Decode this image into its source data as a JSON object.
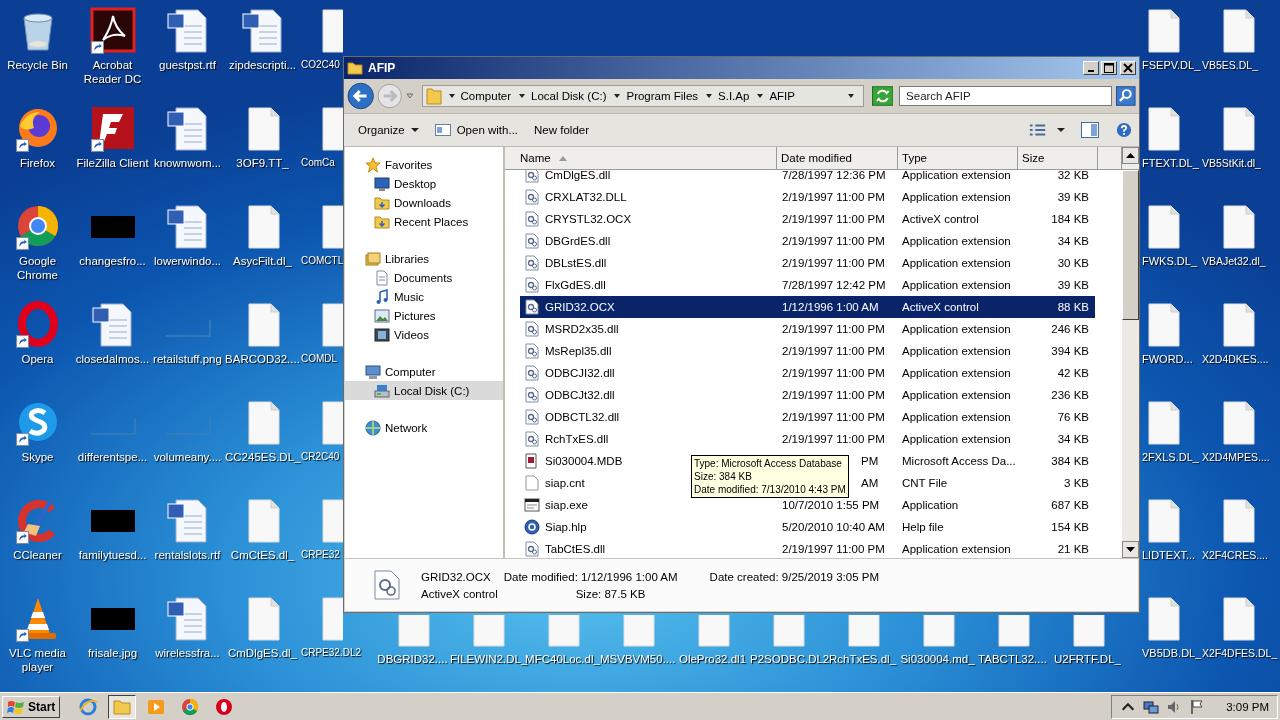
{
  "desktop": {
    "left_columns": [
      [
        {
          "label": "Recycle Bin",
          "kind": "recycle",
          "shortcut": false
        },
        {
          "label": "Firefox",
          "kind": "firefox",
          "shortcut": true
        },
        {
          "label": "Google Chrome",
          "kind": "chrome",
          "shortcut": true
        },
        {
          "label": "Opera",
          "kind": "opera",
          "shortcut": true
        },
        {
          "label": "Skype",
          "kind": "skype",
          "shortcut": true
        },
        {
          "label": "CCleaner",
          "kind": "ccleaner",
          "shortcut": true
        },
        {
          "label": "VLC media player",
          "kind": "vlc",
          "shortcut": true
        }
      ],
      [
        {
          "label": "Acrobat Reader DC",
          "kind": "acrobat",
          "shortcut": true
        },
        {
          "label": "FileZilla Client",
          "kind": "filezilla",
          "shortcut": true
        },
        {
          "label": "changesfro...",
          "kind": "thumb_dark",
          "shortcut": false
        },
        {
          "label": "closedalmos...",
          "kind": "word",
          "shortcut": false
        },
        {
          "label": "differentspe...",
          "kind": "thumb_light",
          "shortcut": false
        },
        {
          "label": "familytuesd...",
          "kind": "thumb_dark",
          "shortcut": false
        },
        {
          "label": "frisale.jpg",
          "kind": "thumb_dark",
          "shortcut": false
        }
      ],
      [
        {
          "label": "guestpst.rtf",
          "kind": "word",
          "shortcut": false
        },
        {
          "label": "knownwom...",
          "kind": "word",
          "shortcut": false
        },
        {
          "label": "lowerwindo...",
          "kind": "word",
          "shortcut": false
        },
        {
          "label": "retailstuff.png",
          "kind": "thumb_light",
          "shortcut": false
        },
        {
          "label": "volumeany....",
          "kind": "thumb_light",
          "shortcut": false
        },
        {
          "label": "rentalslots.rtf",
          "kind": "word",
          "shortcut": false
        },
        {
          "label": "wirelessfra...",
          "kind": "word",
          "shortcut": false
        }
      ],
      [
        {
          "label": "zipdescripti...",
          "kind": "word",
          "shortcut": false
        },
        {
          "label": "3OF9.TT_",
          "kind": "blank",
          "shortcut": false
        },
        {
          "label": "AsycFilt.dl_",
          "kind": "blank",
          "shortcut": false
        },
        {
          "label": "BARCOD32....",
          "kind": "blank",
          "shortcut": false
        },
        {
          "label": "CC245ES.DL_",
          "kind": "blank",
          "shortcut": false
        },
        {
          "label": "CmCtES.dl_",
          "kind": "blank",
          "shortcut": false
        },
        {
          "label": "CmDlgES.dl_",
          "kind": "blank",
          "shortcut": false
        }
      ],
      [
        {
          "label": "CO2C40",
          "kind": "blank",
          "shortcut": false
        },
        {
          "label": "ComCa",
          "kind": "blank",
          "shortcut": false
        },
        {
          "label": "COMCTL",
          "kind": "blank",
          "shortcut": false
        },
        {
          "label": "COMDL",
          "kind": "blank",
          "shortcut": false
        },
        {
          "label": "CR2C40",
          "kind": "blank",
          "shortcut": false
        },
        {
          "label": "CRPE32",
          "kind": "blank",
          "shortcut": false
        },
        {
          "label": "CRPE32.DL2",
          "kind": "blank",
          "shortcut": false
        }
      ]
    ],
    "bottom_row": [
      {
        "label": "DBGRID32....",
        "kind": "blank",
        "shortcut": false
      },
      {
        "label": "FILEWIN2.DL_",
        "kind": "blank",
        "shortcut": false
      },
      {
        "label": "MFC40Loc.dl_",
        "kind": "blank",
        "shortcut": false
      },
      {
        "label": "MSVBVM50....",
        "kind": "blank",
        "shortcut": false
      },
      {
        "label": "OlePro32.dl1",
        "kind": "blank",
        "shortcut": false
      },
      {
        "label": "P2SODBC.DL2",
        "kind": "blank",
        "shortcut": false
      },
      {
        "label": "RchTxES.dl_",
        "kind": "blank",
        "shortcut": false
      },
      {
        "label": "Si030004.md_",
        "kind": "blank",
        "shortcut": false
      },
      {
        "label": "TABCTL32....",
        "kind": "blank",
        "shortcut": false
      },
      {
        "label": "U2FRTF.DL_",
        "kind": "blank",
        "shortcut": false
      }
    ],
    "right_columns": [
      [
        {
          "label": "FSEPV.DL_",
          "kind": "blank",
          "shortcut": false
        },
        {
          "label": "FTEXT.DL_",
          "kind": "blank",
          "shortcut": false
        },
        {
          "label": "FWKS.DL_",
          "kind": "blank",
          "shortcut": false
        },
        {
          "label": "FWORD...",
          "kind": "blank",
          "shortcut": false
        },
        {
          "label": "2FXLS.DL_",
          "kind": "blank",
          "shortcut": false
        },
        {
          "label": "LIDTEXT...",
          "kind": "blank",
          "shortcut": false
        },
        {
          "label": "VB5DB.DL_",
          "kind": "blank",
          "shortcut": false
        }
      ],
      [
        {
          "label": "VB5ES.DL_",
          "kind": "blank",
          "shortcut": false
        },
        {
          "label": "VB5StKit.dl_",
          "kind": "blank",
          "shortcut": false
        },
        {
          "label": "VBAJet32.dl_",
          "kind": "blank",
          "shortcut": false
        },
        {
          "label": "X2D4DKES....",
          "kind": "blank",
          "shortcut": false
        },
        {
          "label": "X2D4MPES....",
          "kind": "blank",
          "shortcut": false
        },
        {
          "label": "X2F4CRES....",
          "kind": "blank",
          "shortcut": false
        },
        {
          "label": "X2F4DFES.DL_",
          "kind": "blank",
          "shortcut": false
        }
      ]
    ]
  },
  "window": {
    "title": "AFIP",
    "breadcrumbs": [
      "Computer",
      "Local Disk (C:)",
      "Program Files",
      "S.I.Ap",
      "AFIP"
    ],
    "search": {
      "placeholder": "Search AFIP"
    },
    "toolbar": [
      {
        "label": "Organize",
        "kind": "menu"
      },
      {
        "label": "Open with...",
        "kind": "open"
      },
      {
        "label": "New folder",
        "kind": "plain"
      }
    ],
    "nav": [
      {
        "label": "Favorites",
        "kind": "star",
        "selected": false,
        "children": [
          {
            "label": "Desktop",
            "kind": "desktop",
            "selected": false
          },
          {
            "label": "Downloads",
            "kind": "downloads",
            "selected": false
          },
          {
            "label": "Recent Places",
            "kind": "recent",
            "selected": false
          }
        ]
      },
      {
        "label": "Libraries",
        "kind": "libraries",
        "selected": false,
        "children": [
          {
            "label": "Documents",
            "kind": "documents",
            "selected": false
          },
          {
            "label": "Music",
            "kind": "music",
            "selected": false
          },
          {
            "label": "Pictures",
            "kind": "pictures",
            "selected": false
          },
          {
            "label": "Videos",
            "kind": "videos",
            "selected": false
          }
        ]
      },
      {
        "label": "Computer",
        "kind": "computer",
        "selected": false,
        "children": [
          {
            "label": "Local Disk (C:)",
            "kind": "disk",
            "selected": true
          }
        ]
      },
      {
        "label": "Network",
        "kind": "network",
        "selected": false
      }
    ],
    "columns": [
      {
        "label": "Name",
        "sorted": true
      },
      {
        "label": "Date modified",
        "sorted": false
      },
      {
        "label": "Type",
        "sorted": false
      },
      {
        "label": "Size",
        "sorted": false
      }
    ],
    "files": [
      {
        "name": "CmDlgES.dll",
        "date": "7/28/1997 12:36 PM",
        "type": "Application extension",
        "size": "32 KB",
        "kind": "dll",
        "selected": false
      },
      {
        "name": "CRXLAT32.DLL",
        "date": "2/19/1997 11:00 PM",
        "type": "Application extension",
        "size": "39 KB",
        "kind": "dll",
        "selected": false
      },
      {
        "name": "CRYSTL32.OCX",
        "date": "2/19/1997 11:00 PM",
        "type": "ActiveX control",
        "size": "184 KB",
        "kind": "dll",
        "selected": false
      },
      {
        "name": "DBGrdES.dll",
        "date": "2/19/1997 11:00 PM",
        "type": "Application extension",
        "size": "34 KB",
        "kind": "dll",
        "selected": false
      },
      {
        "name": "DBLstES.dll",
        "date": "2/19/1997 11:00 PM",
        "type": "Application extension",
        "size": "30 KB",
        "kind": "dll",
        "selected": false
      },
      {
        "name": "FlxGdES.dll",
        "date": "7/28/1997 12:42 PM",
        "type": "Application extension",
        "size": "39 KB",
        "kind": "dll",
        "selected": false
      },
      {
        "name": "GRID32.OCX",
        "date": "1/12/1996 1:00 AM",
        "type": "ActiveX control",
        "size": "88 KB",
        "kind": "dll",
        "selected": true
      },
      {
        "name": "MSRD2x35.dll",
        "date": "2/19/1997 11:00 PM",
        "type": "Application extension",
        "size": "246 KB",
        "kind": "dll",
        "selected": false
      },
      {
        "name": "MsRepl35.dll",
        "date": "2/19/1997 11:00 PM",
        "type": "Application extension",
        "size": "394 KB",
        "kind": "dll",
        "selected": false
      },
      {
        "name": "ODBCJI32.dll",
        "date": "2/19/1997 11:00 PM",
        "type": "Application extension",
        "size": "42 KB",
        "kind": "dll",
        "selected": false
      },
      {
        "name": "ODBCJt32.dll",
        "date": "2/19/1997 11:00 PM",
        "type": "Application extension",
        "size": "236 KB",
        "kind": "dll",
        "selected": false
      },
      {
        "name": "ODBCTL32.dll",
        "date": "2/19/1997 11:00 PM",
        "type": "Application extension",
        "size": "76 KB",
        "kind": "dll",
        "selected": false
      },
      {
        "name": "RchTxES.dll",
        "date": "2/19/1997 11:00 PM",
        "type": "Application extension",
        "size": "34 KB",
        "kind": "dll",
        "selected": false
      },
      {
        "name": "Si030004.MDB",
        "date": "PM",
        "date_covered": true,
        "type": "Microsoft Access Da...",
        "size": "384 KB",
        "kind": "mdb",
        "selected": false
      },
      {
        "name": "siap.cnt",
        "date": "AM",
        "date_covered": true,
        "type": "CNT File",
        "size": "3 KB",
        "kind": "blank",
        "selected": false
      },
      {
        "name": "siap.exe",
        "date": "10/7/2010 1:55 PM",
        "type": "Application",
        "size": "687 KB",
        "kind": "exe",
        "selected": false
      },
      {
        "name": "Siap.hlp",
        "date": "5/20/2010 10:40 AM",
        "type": "Help file",
        "size": "154 KB",
        "kind": "help",
        "selected": false
      },
      {
        "name": "TabCtES.dll",
        "date": "2/19/1997 11:00 PM",
        "type": "Application extension",
        "size": "21 KB",
        "kind": "dll",
        "selected": false
      }
    ],
    "tooltip": [
      "Type: Microsoft Access Database",
      "Size: 384 KB",
      "Date modified: 7/13/2010 4:43 PM"
    ],
    "details": {
      "name": "GRID32.OCX",
      "type": "ActiveX control",
      "modified": "Date modified: 1/12/1996 1:00 AM",
      "created": "Date created: 9/25/2019 3:05 PM",
      "size": "Size: 87.5 KB"
    }
  },
  "taskbar": {
    "start": "Start",
    "apps": [
      {
        "kind": "ie",
        "selected": false
      },
      {
        "kind": "explorer",
        "selected": true
      },
      {
        "kind": "media",
        "selected": false
      },
      {
        "kind": "chrome",
        "selected": false
      },
      {
        "kind": "opera",
        "selected": false
      }
    ],
    "clock": "3:09 PM"
  }
}
